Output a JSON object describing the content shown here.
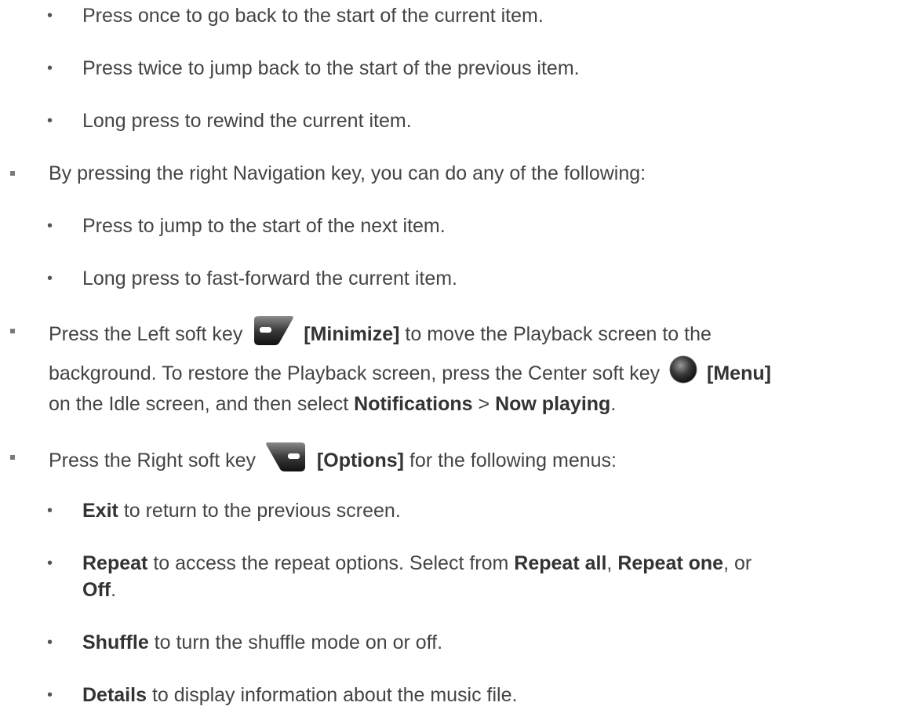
{
  "items": {
    "prev_once": "Press once to go back to the start of the current item.",
    "prev_twice": "Press twice to jump back to the start of the previous item.",
    "prev_long": "Long press to rewind the current item.",
    "right_nav": "By pressing the right Navigation key, you can do any of the following:",
    "next_press": "Press to jump to the start of the next item.",
    "next_long": "Long press to fast-forward the current item.",
    "left_soft_pre": "Press the Left soft key",
    "left_soft_label": "[Minimize]",
    "left_soft_post": "to move the Playback screen to the",
    "left_soft_line2_pre": "background. To restore the Playback screen, press the Center soft key",
    "center_soft_label": "[Menu]",
    "left_soft_line3_pre": "on the Idle screen, and then select",
    "notifications": "Notifications",
    "gt": ">",
    "now_playing": "Now playing",
    "period": ".",
    "right_soft_pre": "Press the Right soft key",
    "right_soft_label": "[Options]",
    "right_soft_post": "for the following menus:",
    "exit": "Exit",
    "exit_desc": "to return to the previous screen.",
    "repeat": "Repeat",
    "repeat_desc": "to access the repeat options. Select from",
    "repeat_all": "Repeat all",
    "comma": ",",
    "repeat_one": "Repeat one",
    "or": ", or",
    "off": "Off",
    "shuffle": "Shuffle",
    "shuffle_desc": "to turn the shuffle mode on or off.",
    "details": "Details",
    "details_desc": "to display information about the music file."
  },
  "icons": {
    "left_soft_key": "left-soft-key-icon",
    "center_soft_key": "center-soft-key-icon",
    "right_soft_key": "right-soft-key-icon"
  },
  "colors": {
    "text": "#444444",
    "bold": "#333333",
    "bullet": "#7a7a7a"
  }
}
